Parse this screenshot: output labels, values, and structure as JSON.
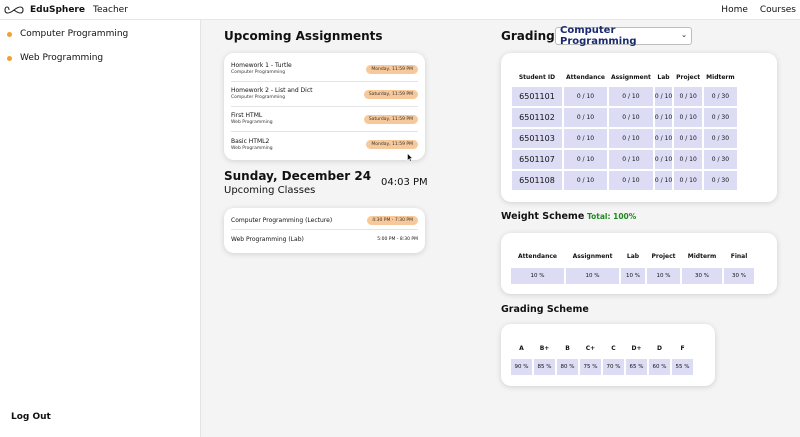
{
  "header": {
    "brand": "EduSphere",
    "role": "Teacher",
    "nav": [
      "Home",
      "Courses"
    ]
  },
  "sidebar": {
    "items": [
      {
        "label": "Computer Programming"
      },
      {
        "label": "Web Programming"
      }
    ],
    "logout": "Log Out"
  },
  "assignments": {
    "title": "Upcoming Assignments",
    "items": [
      {
        "name": "Homework 1 - Turtle",
        "course": "Computer Programming",
        "due": "Monday, 11:59 PM"
      },
      {
        "name": "Homework 2 - List and Dict",
        "course": "Computer Programming",
        "due": "Saturday, 11:59 PM"
      },
      {
        "name": "First HTML",
        "course": "Web Programming",
        "due": "Saturday, 11:59 PM"
      },
      {
        "name": "Basic HTML2",
        "course": "Web Programming",
        "due": "Monday, 11:59 PM"
      }
    ]
  },
  "schedule": {
    "date": "Sunday, December 24",
    "time": "04:03 PM",
    "title": "Upcoming Classes",
    "classes": [
      {
        "name": "Computer Programming (Lecture)",
        "time": "4:30 PM - 7:30 PM"
      },
      {
        "name": "Web Programming (Lab)",
        "time": "5:00 PM - 8:30 PM"
      }
    ]
  },
  "grading": {
    "label": "Grading:",
    "selected_course": "Computer Programming",
    "columns": [
      "Student ID",
      "Attendance",
      "Assignment",
      "Lab",
      "Project",
      "Midterm"
    ],
    "rows": [
      {
        "id": "6501101",
        "cells": [
          "0 / 10",
          "0 / 10",
          "0 / 10",
          "0 / 10",
          "0 / 30"
        ]
      },
      {
        "id": "6501102",
        "cells": [
          "0 / 10",
          "0 / 10",
          "0 / 10",
          "0 / 10",
          "0 / 30"
        ]
      },
      {
        "id": "6501103",
        "cells": [
          "0 / 10",
          "0 / 10",
          "0 / 10",
          "0 / 10",
          "0 / 30"
        ]
      },
      {
        "id": "6501107",
        "cells": [
          "0 / 10",
          "0 / 10",
          "0 / 10",
          "0 / 10",
          "0 / 30"
        ]
      },
      {
        "id": "6501108",
        "cells": [
          "0 / 10",
          "0 / 10",
          "0 / 10",
          "0 / 10",
          "0 / 30"
        ]
      }
    ]
  },
  "weight": {
    "title": "Weight Scheme",
    "total": "Total: 100%",
    "columns": [
      "Attendance",
      "Assignment",
      "Lab",
      "Project",
      "Midterm",
      "Final"
    ],
    "values": [
      "10 %",
      "10 %",
      "10 %",
      "10 %",
      "30 %",
      "30 %"
    ]
  },
  "scheme": {
    "title": "Grading Scheme",
    "grades": [
      "A",
      "B+",
      "B",
      "C+",
      "C",
      "D+",
      "D",
      "F"
    ],
    "values": [
      "90 %",
      "85 %",
      "80 %",
      "75 %",
      "70 %",
      "65 %",
      "60 %",
      "55 %"
    ]
  }
}
